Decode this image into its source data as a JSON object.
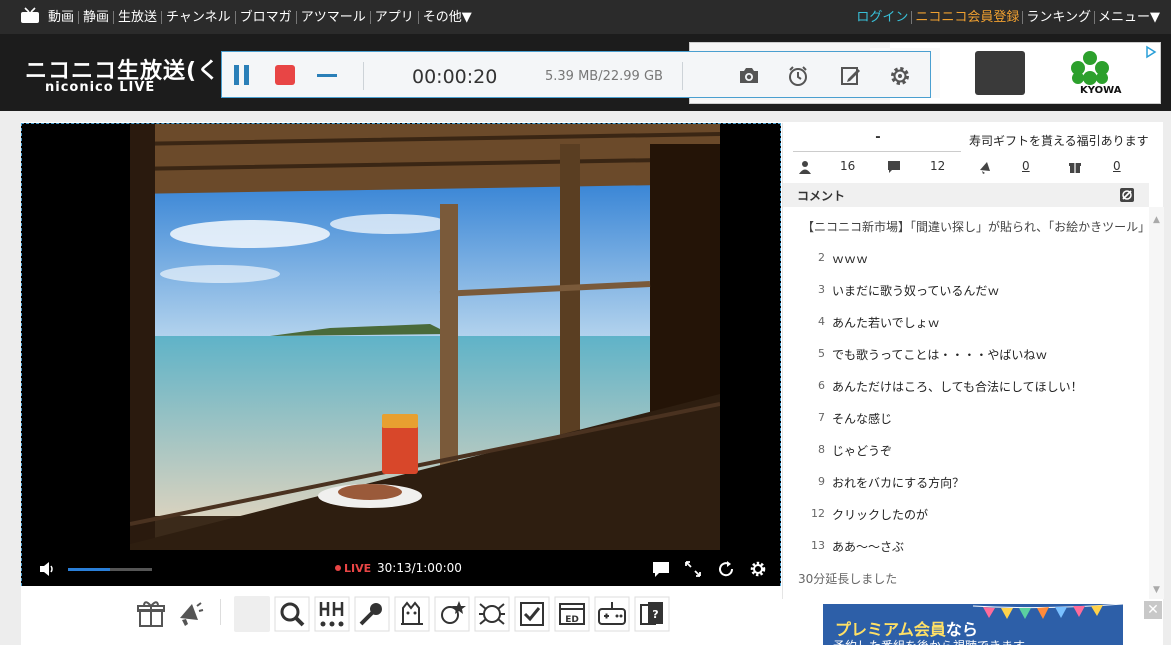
{
  "topnav": {
    "left": [
      "動画",
      "静画",
      "生放送",
      "チャンネル",
      "ブロマガ",
      "アツマール",
      "アプリ",
      "その他▼"
    ],
    "login": "ログイン",
    "register": "ニコニコ会員登録",
    "ranking": "ランキング",
    "menu": "メニュー▼"
  },
  "logo": {
    "ja": "ニコニコ生放送(く)",
    "en": "niconico LIVE"
  },
  "recorder": {
    "elapsed": "00:00:20",
    "size": "5.39 MB/22.99 GB"
  },
  "ad": {
    "brand": "KYOWA"
  },
  "player": {
    "live_label": "LIVE",
    "time": "30:13/1:00:00",
    "volume_fraction": 0.5
  },
  "panel": {
    "title": "-",
    "gift_msg": "寿司ギフトを貰える福引あります",
    "stats": {
      "viewers": "16",
      "comments": "12",
      "ads": "0",
      "gifts": "0"
    },
    "comment_header": "コメント",
    "notice": "【ニコニコ新市場】「間違い探し」が貼られ、「お絵かきツール」が",
    "comments": [
      {
        "no": "2",
        "text": "ｗｗｗ"
      },
      {
        "no": "3",
        "text": "いまだに歌う奴っているんだｗ"
      },
      {
        "no": "4",
        "text": "あんた若いでしょｗ"
      },
      {
        "no": "5",
        "text": "でも歌うってことは・・・・やばいねｗ"
      },
      {
        "no": "6",
        "text": "あんただけはころ、しても合法にしてほしい！"
      },
      {
        "no": "7",
        "text": "そんな感じ"
      },
      {
        "no": "8",
        "text": "じゃどうぞ"
      },
      {
        "no": "9",
        "text": "おれをバカにする方向？"
      },
      {
        "no": "12",
        "text": "クリックしたのが"
      },
      {
        "no": "13",
        "text": "ああ～～さぶ"
      }
    ],
    "extension": "30分延長しました"
  },
  "premium": {
    "line1": "プレミアム会員",
    "line1_suffix": "なら",
    "line2": "予約した番組を後から視聴できます"
  },
  "colors": {
    "accent": "#2a7fb8",
    "record": "#e84545",
    "login": "#38c0d8",
    "register": "#f0a030"
  }
}
